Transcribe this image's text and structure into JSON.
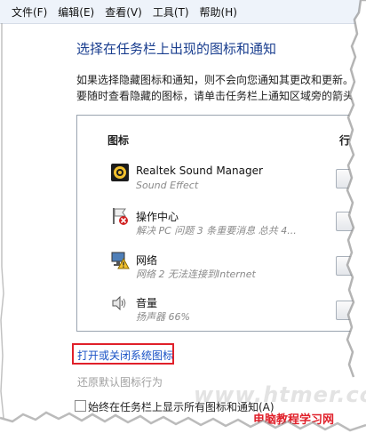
{
  "menubar": {
    "items": [
      "文件(F)",
      "编辑(E)",
      "查看(V)",
      "工具(T)",
      "帮助(H)"
    ]
  },
  "heading": "选择在任务栏上出现的图标和通知",
  "description": "如果选择隐藏图标和通知，则不会向您通知其更改和更新。若要随时查看隐藏的图标，请单击任务栏上通知区域旁的箭头。",
  "table": {
    "col_icons": "图标",
    "col_behavior": "行为",
    "rows": [
      {
        "icon": "speaker-device-icon",
        "name": "Realtek Sound Manager",
        "sub": "Sound Effect"
      },
      {
        "icon": "action-center-flag-icon",
        "name": "操作中心",
        "sub": "解决 PC 问题  3 条重要消息 总共 4..."
      },
      {
        "icon": "network-warning-icon",
        "name": "网络",
        "sub": "网络 2 无法连接到Internet"
      },
      {
        "icon": "volume-icon",
        "name": "音量",
        "sub": "扬声器 66%"
      }
    ]
  },
  "links": {
    "system_icons": "打开或关闭系统图标",
    "restore_defaults": "还原默认图标行为"
  },
  "bottom_checkbox_text": "始终在任务栏上显示所有图标和通知(A)",
  "watermark": "www.htmer.com",
  "site_label": "电脑教程学习网",
  "colors": {
    "heading": "#1a3e8f",
    "link": "#1a52c6",
    "highlight_box": "#e0202a",
    "menubar_bg": "#eef3fa"
  }
}
